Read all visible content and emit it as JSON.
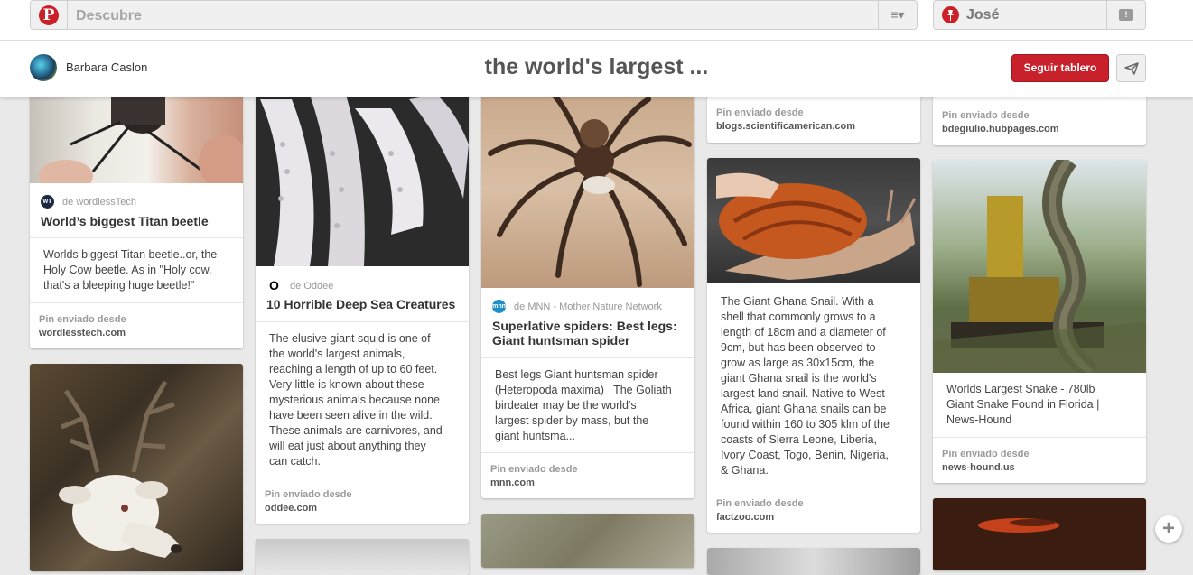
{
  "search": {
    "placeholder": "Descubre"
  },
  "user": {
    "name": "José"
  },
  "board": {
    "author": "Barbara Caslon",
    "title": "the world's largest ...",
    "follow_label": "Seguir tablero"
  },
  "icons": {
    "pinterest_logo": "P",
    "menu": "≡▾",
    "user_pin": "pin-icon",
    "notifications": "notifications-icon",
    "send": "paper-plane-icon",
    "zoom": "+"
  },
  "pins": [
    {
      "source_prefix": "de",
      "source": "wordlessTech",
      "source_icon": "wT",
      "title": "World’s biggest Titan beetle",
      "description": [
        "Worlds biggest Titan beetle..or, the",
        "Holy Cow beetle. As in \"Holy cow,",
        "that's a bleeping huge beetle!\""
      ],
      "footer_label": "Pin enviado desde",
      "site": "wordlesstech.com"
    },
    {
      "source_prefix": "de",
      "source": "Oddee",
      "source_icon": "O",
      "title": "10 Horrible Deep Sea Creatures",
      "description": [
        "The elusive giant squid is one of",
        "the world's largest animals,",
        "reaching a length of up to 60 feet.",
        "Very little is known about these",
        "mysterious animals because none",
        "have been seen alive in the wild.",
        "These animals are carnivores, and",
        "will eat just about anything they",
        "can catch."
      ],
      "footer_label": "Pin enviado desde",
      "site": "oddee.com"
    },
    {
      "source_prefix": "de",
      "source": "MNN - Mother Nature Network",
      "source_icon": "mnn",
      "title": "Superlative spiders: Best legs:",
      "title2": "Giant huntsman spider",
      "description": [
        "Best legs Giant huntsman spider",
        "(Heteropoda maxima)   The Goliath",
        "birdeater may be the world's",
        "largest spider by mass, but the",
        "giant huntsma..."
      ],
      "footer_label": "Pin enviado desde",
      "site": "mnn.com"
    },
    {
      "footer_label": "Pin enviado desde",
      "site": "blogs.scientificamerican.com"
    },
    {
      "description": [
        "The Giant Ghana Snail. With a",
        "shell that commonly grows to a",
        "length of 18cm and a diameter of",
        "9cm, but has been observed to",
        "grow as large as 30x15cm, the",
        "giant Ghana snail is the world's",
        "largest land snail. Native to West",
        "Africa, giant Ghana snails can be",
        "found within 160 to 305 klm of the",
        "coasts of Sierra Leone, Liberia,",
        "Ivory Coast, Togo, Benin, Nigeria,",
        "& Ghana."
      ],
      "footer_label": "Pin enviado desde",
      "site": "factzoo.com"
    },
    {
      "footer_label": "Pin enviado desde",
      "site": "bdegiulio.hubpages.com"
    },
    {
      "description": [
        "Worlds Largest Snake - 780lb",
        "Giant Snake Found in Florida |",
        "News-Hound"
      ],
      "footer_label": "Pin enviado desde",
      "site": "news-hound.us"
    }
  ]
}
